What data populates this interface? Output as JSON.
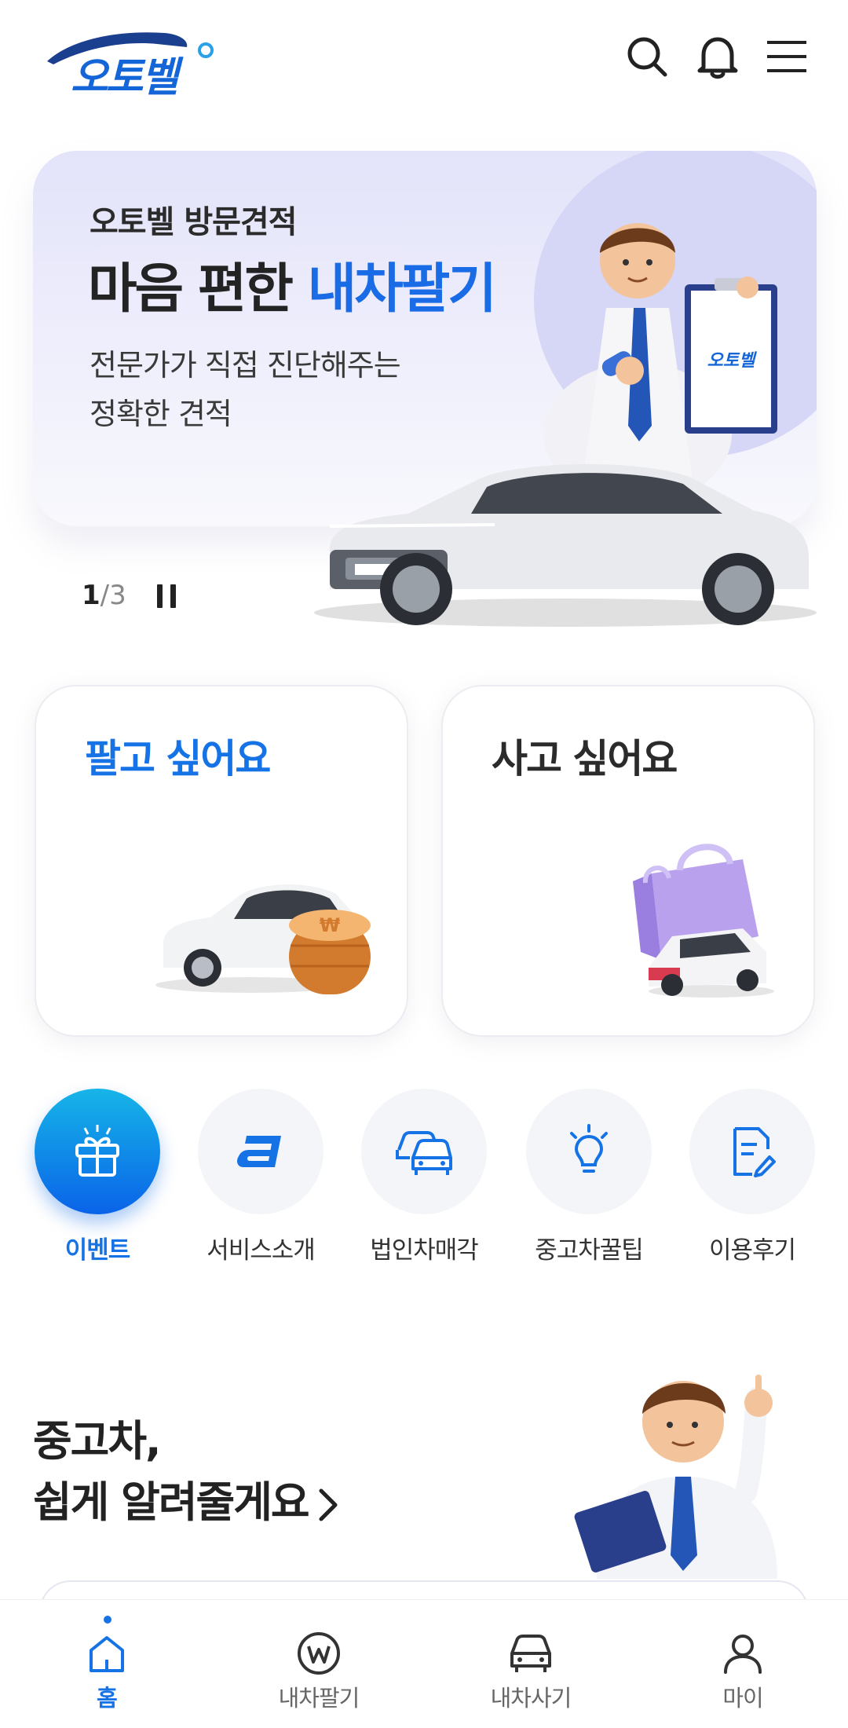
{
  "header": {
    "logo_text": "오토벨",
    "icons": [
      "search-icon",
      "bell-icon",
      "menu-icon"
    ]
  },
  "banner": {
    "subtitle": "오토벨 방문견적",
    "title_prefix": "마음 편한 ",
    "title_highlight": "내차팔기",
    "description_line1": "전문가가 직접 진단해주는",
    "description_line2": "정확한 견적",
    "clipboard_logo": "오토벨",
    "pager_current": "1",
    "pager_separator": "/",
    "pager_total": "3"
  },
  "cards": {
    "sell_label": "팔고 싶어요",
    "buy_label": "사고 싶어요"
  },
  "quick_menu": [
    {
      "label": "이벤트",
      "icon": "gift-icon",
      "active": true
    },
    {
      "label": "서비스소개",
      "icon": "autobell-a-icon",
      "active": false
    },
    {
      "label": "법인차매각",
      "icon": "cars-icon",
      "active": false
    },
    {
      "label": "중고차꿀팁",
      "icon": "lightbulb-icon",
      "active": false
    },
    {
      "label": "이용후기",
      "icon": "review-note-icon",
      "active": false
    }
  ],
  "tips": {
    "line1": "중고차,",
    "line2": "쉽게 알려줄게요"
  },
  "bottom_nav": [
    {
      "label": "홈",
      "icon": "home-icon",
      "active": true
    },
    {
      "label": "내차팔기",
      "icon": "won-icon",
      "active": false
    },
    {
      "label": "내차사기",
      "icon": "car-icon",
      "active": false
    },
    {
      "label": "마이",
      "icon": "person-icon",
      "active": false
    }
  ],
  "colors": {
    "primary": "#1673e6",
    "banner_bg": "#e9e9fb",
    "text_dark": "#222222"
  }
}
